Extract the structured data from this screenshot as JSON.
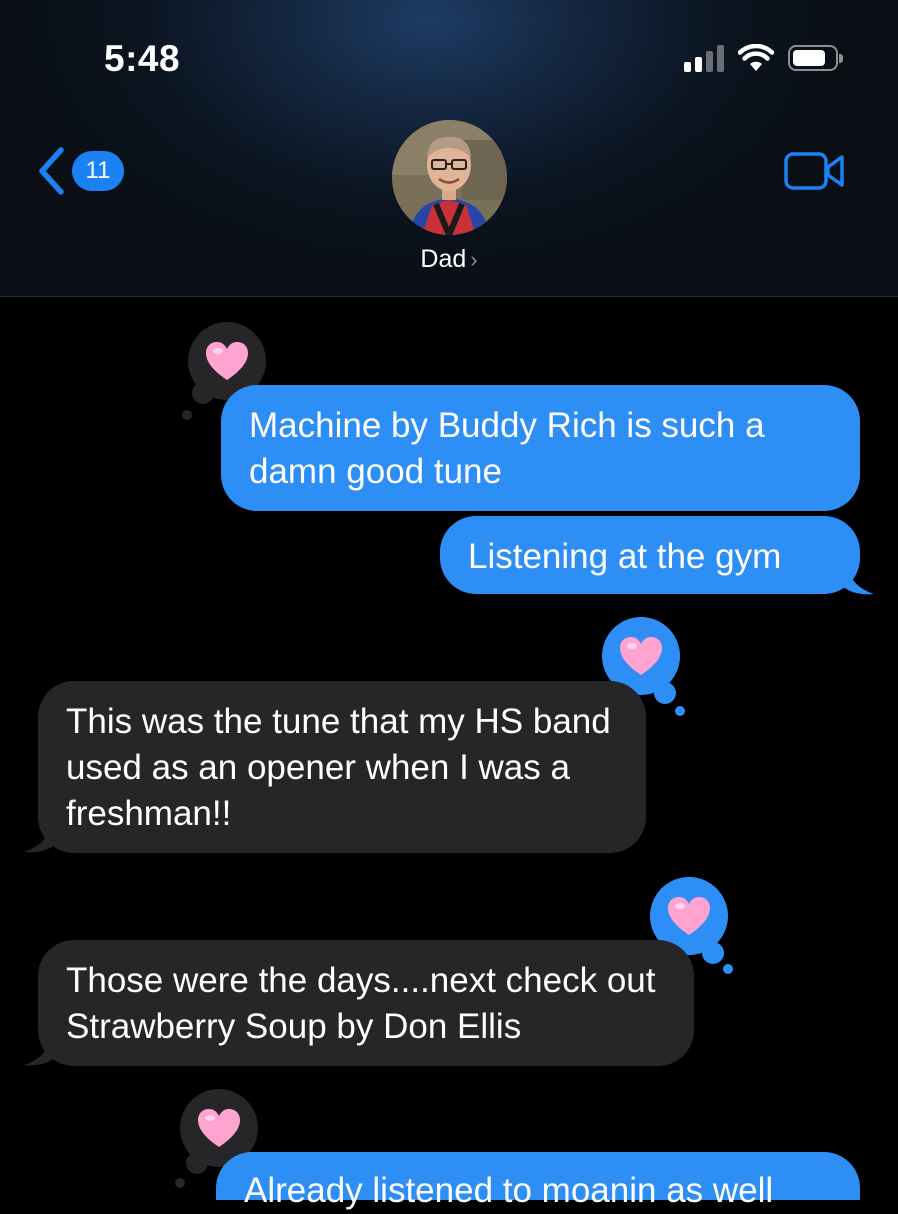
{
  "status_bar": {
    "time": "5:48"
  },
  "nav": {
    "back_count": "11",
    "contact_name": "Dad"
  },
  "messages": [
    {
      "direction": "outgoing",
      "text": "Machine by Buddy Rich is such a damn good tune",
      "tapback": "heart"
    },
    {
      "direction": "outgoing",
      "text": "Listening at the gym"
    },
    {
      "direction": "incoming",
      "text": "This was the tune that my HS band used as an opener when I was a freshman!!",
      "tapback": "heart"
    },
    {
      "direction": "incoming",
      "text": "Those were the days....next check out Strawberry Soup by Don Ellis",
      "tapback": "heart"
    },
    {
      "direction": "outgoing",
      "text": "Already listened to moanin as well",
      "tapback": "heart"
    }
  ],
  "colors": {
    "outgoing_bubble": "#2d8ef6",
    "incoming_bubble": "#262628",
    "accent": "#1a82f4",
    "heart": "#ffa3d1"
  },
  "icons": {
    "back": "chevron-left-icon",
    "video": "video-camera-icon",
    "tapback": "heart-icon"
  }
}
